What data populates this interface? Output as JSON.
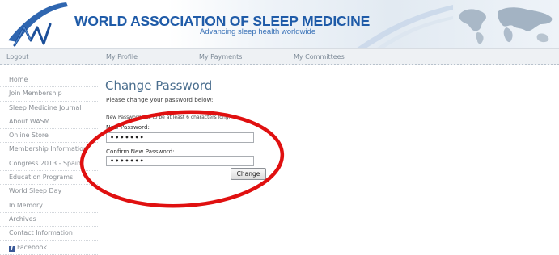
{
  "header": {
    "org_name": "WORLD ASSOCIATION OF SLEEP MEDICINE",
    "tagline": "Advancing sleep health worldwide"
  },
  "topnav": [
    {
      "label": "Logout"
    },
    {
      "label": "My Profile"
    },
    {
      "label": "My Payments"
    },
    {
      "label": "My Committees"
    }
  ],
  "sidebar": {
    "items": [
      {
        "label": "Home"
      },
      {
        "label": "Join Membership"
      },
      {
        "label": "Sleep Medicine Journal"
      },
      {
        "label": "About WASM"
      },
      {
        "label": "Online Store"
      },
      {
        "label": "Membership Information"
      },
      {
        "label": "Congress 2013 - Spain"
      },
      {
        "label": "Education Programs"
      },
      {
        "label": "World Sleep Day"
      },
      {
        "label": "In Memory"
      },
      {
        "label": "Archives"
      },
      {
        "label": "Contact Information"
      },
      {
        "label": "Facebook"
      }
    ]
  },
  "main": {
    "title": "Change Password",
    "intro": "Please change your password below:",
    "hint": "New Password has to be at least 6 characters long.",
    "new_password_label": "New Password:",
    "new_password_value": "•••••••",
    "confirm_label": "Confirm New Password:",
    "confirm_value": "•••••••",
    "change_button": "Change"
  },
  "colors": {
    "brand_blue": "#1f5ba8",
    "highlight_ellipse": "#e01010",
    "title_color": "#4a6e8e"
  },
  "icons": [
    "wasm-logo-swoosh-icon",
    "world-map-icon",
    "facebook-icon"
  ]
}
